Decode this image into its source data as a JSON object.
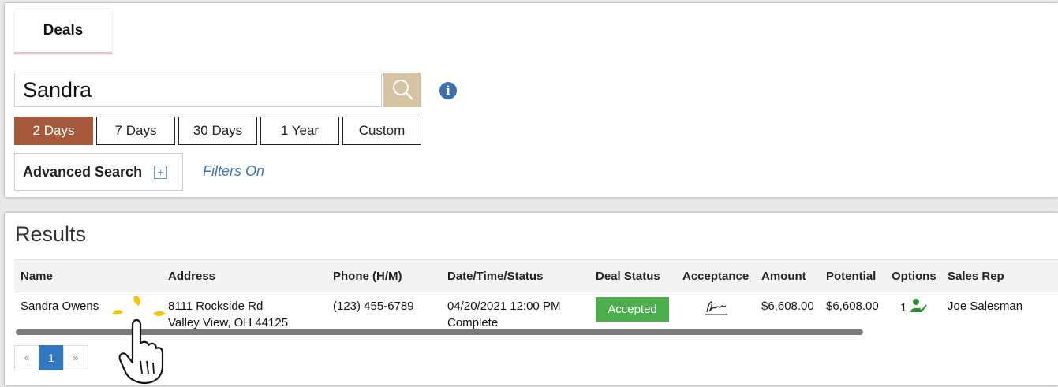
{
  "tab": {
    "label": "Deals"
  },
  "search": {
    "value": "Sandra"
  },
  "ranges": [
    "2 Days",
    "7 Days",
    "30 Days",
    "1 Year",
    "Custom"
  ],
  "advanced": {
    "label": "Advanced Search",
    "filters": "Filters On"
  },
  "results": {
    "title": "Results",
    "columns": [
      "Name",
      "Address",
      "Phone (H/M)",
      "Date/Time/Status",
      "Deal Status",
      "Acceptance",
      "Amount",
      "Potential",
      "Options",
      "Sales Rep"
    ],
    "row": {
      "name": "Sandra Owens",
      "address1": "8111 Rockside Rd",
      "address2": "Valley View, OH 44125",
      "phone": "(123) 455-6789",
      "datetime": "04/20/2021 12:00 PM",
      "status": "Complete",
      "deal_status": "Accepted",
      "amount": "$6,608.00",
      "potential": "$6,608.00",
      "options_count": "1",
      "sales_rep": "Joe Salesman"
    }
  },
  "pagination": {
    "prev": "«",
    "current": "1",
    "next": "»"
  },
  "colors": {
    "active_range": "#a65a3b",
    "search_button": "#d6c3a3",
    "accepted": "#4cae4c",
    "link": "#3b78b8"
  }
}
